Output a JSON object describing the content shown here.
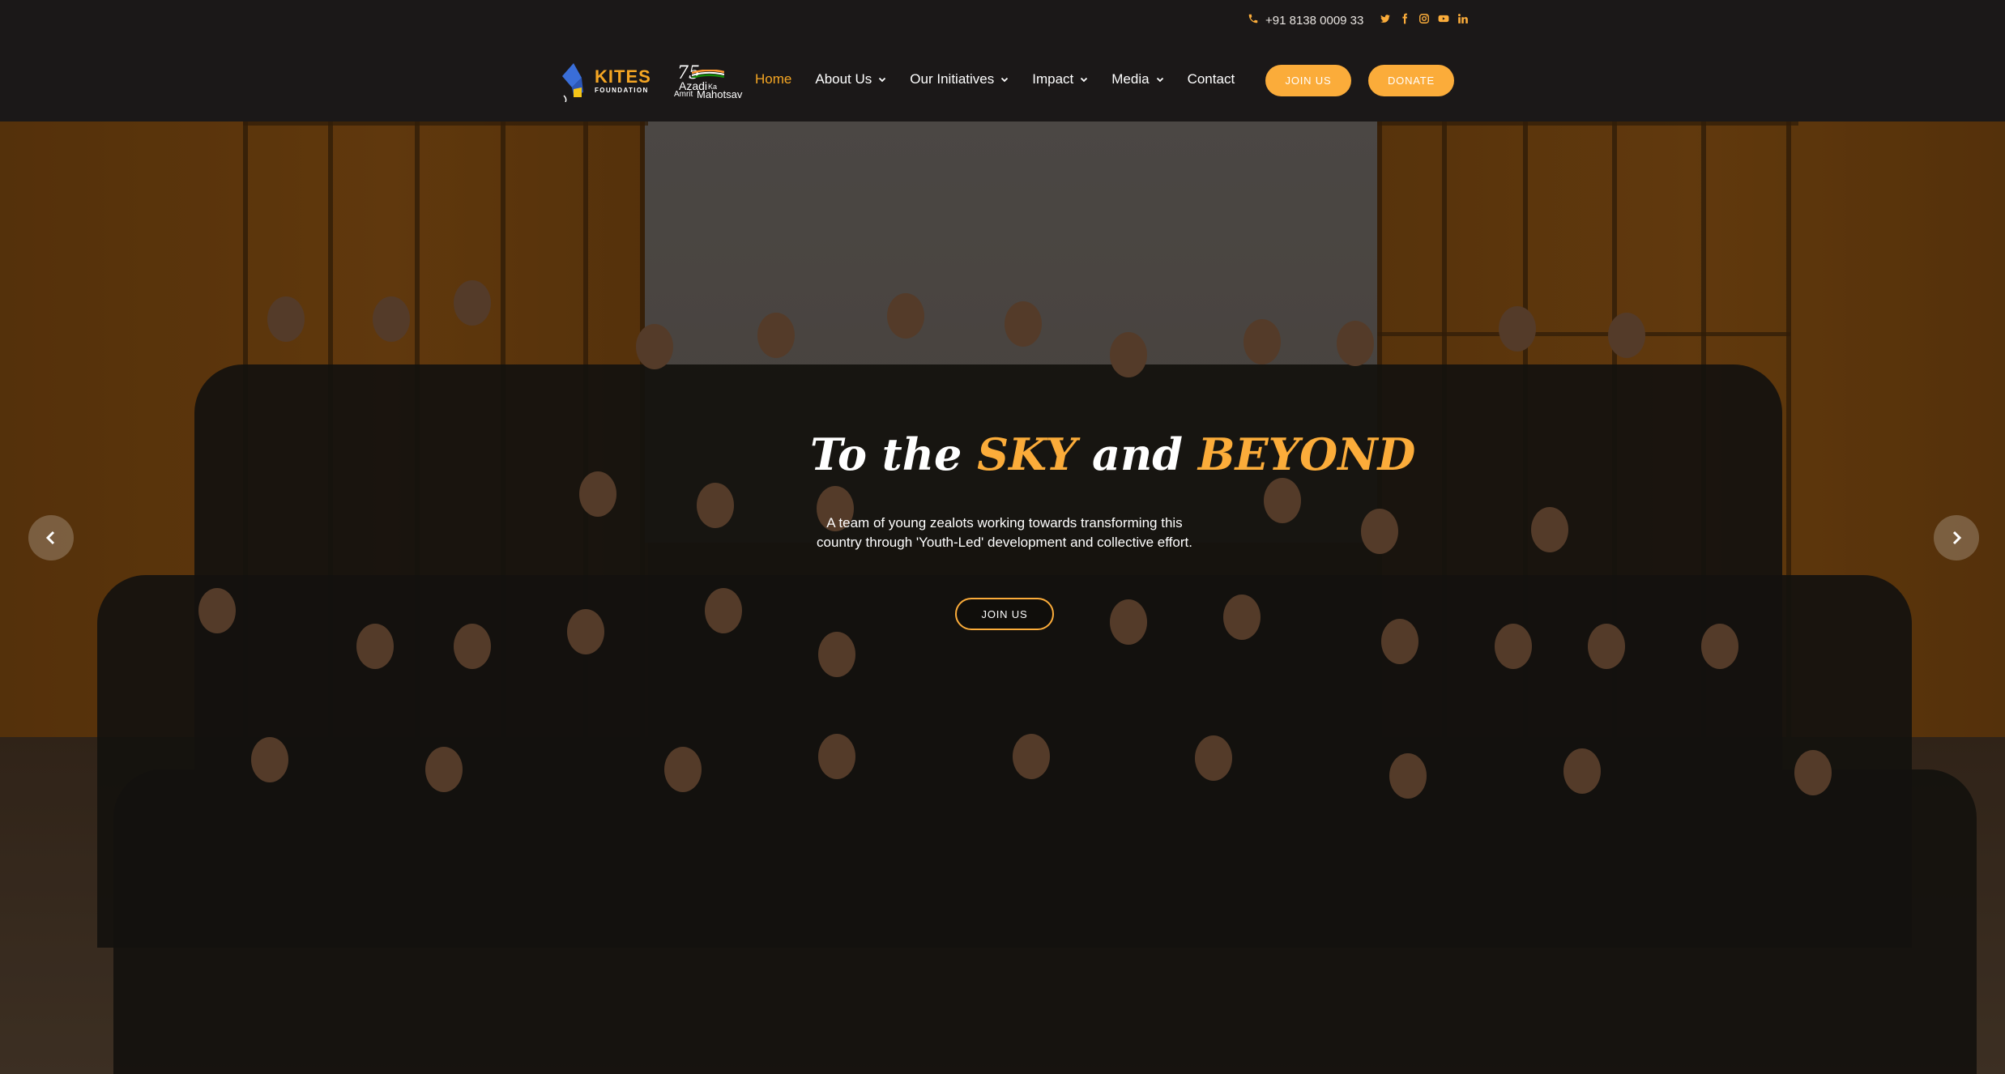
{
  "topbar": {
    "phone": "+91 8138 0009 33",
    "socials": [
      "twitter-icon",
      "facebook-icon",
      "instagram-icon",
      "youtube-icon",
      "linkedin-icon"
    ]
  },
  "logo": {
    "brand": "KITES",
    "subtitle": "FOUNDATION"
  },
  "badge": {
    "number": "75",
    "line1": "Azadi",
    "line2": "Ka",
    "line3": "Amrit",
    "line4": "Mahotsav"
  },
  "nav": {
    "items": [
      {
        "label": "Home",
        "active": true,
        "dropdown": false
      },
      {
        "label": "About Us",
        "active": false,
        "dropdown": true
      },
      {
        "label": "Our Initiatives",
        "active": false,
        "dropdown": true
      },
      {
        "label": "Impact",
        "active": false,
        "dropdown": true
      },
      {
        "label": "Media",
        "active": false,
        "dropdown": true
      },
      {
        "label": "Contact",
        "active": false,
        "dropdown": false
      }
    ],
    "join_label": "JOIN US",
    "donate_label": "DONATE"
  },
  "hero": {
    "headline": {
      "part1": "To the ",
      "part2": "SKY",
      "part3": " and ",
      "part4": "BEYOND"
    },
    "subtitle": "A team of young zealots working towards transforming this country through 'Youth-Led' development and collective effort.",
    "cta_label": "JOIN US"
  },
  "colors": {
    "accent": "#fbac3a",
    "background": "#1b1818",
    "text": "#ffffff"
  }
}
